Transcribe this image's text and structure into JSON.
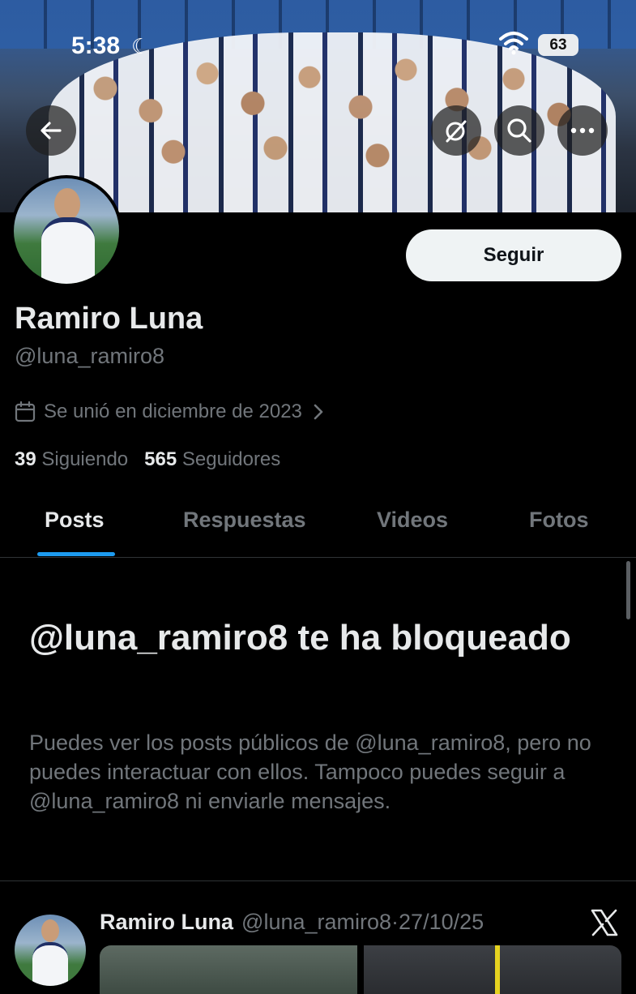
{
  "status_bar": {
    "time": "5:38",
    "battery": "63"
  },
  "profile": {
    "follow_label": "Seguir",
    "name": "Ramiro Luna",
    "handle": "@luna_ramiro8",
    "joined": "Se unió en diciembre de 2023",
    "following_count": "39",
    "following_label": "Siguiendo",
    "followers_count": "565",
    "followers_label": "Seguidores"
  },
  "tabs": [
    {
      "label": "Posts",
      "active": true
    },
    {
      "label": "Respuestas",
      "active": false
    },
    {
      "label": "Videos",
      "active": false
    },
    {
      "label": "Fotos",
      "active": false
    }
  ],
  "blocked": {
    "title": "@luna_ramiro8 te ha bloqueado",
    "description": "Puedes ver los posts públicos de @luna_ramiro8, pero no puedes interactuar con ellos. Tampoco puedes seguir a @luna_ramiro8 ni enviarle mensajes."
  },
  "post": {
    "author_name": "Ramiro Luna",
    "author_handle": "@luna_ramiro8",
    "separator": "·",
    "date": "27/10/25"
  },
  "colors": {
    "background": "#000000",
    "accent": "#1d9bf0",
    "muted_text": "#71767b",
    "primary_text": "#e7e9ea"
  },
  "icons": [
    "back-arrow-icon",
    "grok-icon",
    "search-icon",
    "more-icon",
    "calendar-icon",
    "chevron-right-icon",
    "x-logo-icon",
    "wifi-icon",
    "moon-icon"
  ]
}
